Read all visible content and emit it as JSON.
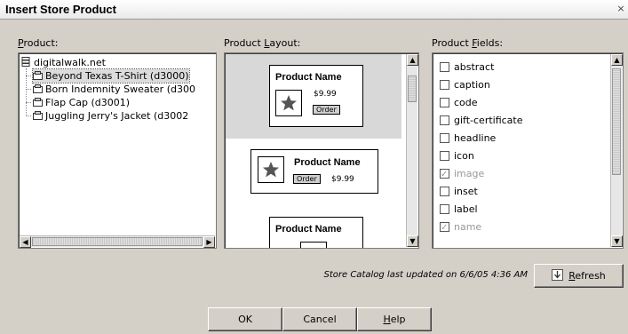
{
  "window": {
    "title": "Insert Store Product",
    "close_glyph": "×"
  },
  "product_panel": {
    "label_prefix": "",
    "label_underline": "P",
    "label_rest": "roduct:",
    "root": "digitalwalk.net",
    "items": [
      {
        "label": "Beyond Texas T-Shirt (d3000)",
        "selected": true
      },
      {
        "label": "Born Indemnity Sweater (d300",
        "selected": false
      },
      {
        "label": "Flap Cap (d3001)",
        "selected": false
      },
      {
        "label": "Juggling Jerry's Jacket (d3002",
        "selected": false
      }
    ]
  },
  "layout_panel": {
    "label_prefix": "Product ",
    "label_underline": "L",
    "label_rest": "ayout:",
    "layouts": [
      {
        "name": "Product Name",
        "price": "$9.99",
        "order": "Order",
        "selected": true
      },
      {
        "name": "Product Name",
        "price": "$9.99",
        "order": "Order",
        "selected": false
      },
      {
        "name": "Product Name",
        "selected": false
      }
    ]
  },
  "fields_panel": {
    "label_prefix": "Product ",
    "label_underline": "F",
    "label_rest": "ields:",
    "fields": [
      {
        "label": "abstract",
        "checked": false,
        "disabled": false
      },
      {
        "label": "caption",
        "checked": false,
        "disabled": false
      },
      {
        "label": "code",
        "checked": false,
        "disabled": false
      },
      {
        "label": "gift-certificate",
        "checked": false,
        "disabled": false
      },
      {
        "label": "headline",
        "checked": false,
        "disabled": false
      },
      {
        "label": "icon",
        "checked": false,
        "disabled": false
      },
      {
        "label": "image",
        "checked": true,
        "disabled": true
      },
      {
        "label": "inset",
        "checked": false,
        "disabled": false
      },
      {
        "label": "label",
        "checked": false,
        "disabled": false
      },
      {
        "label": "name",
        "checked": true,
        "disabled": true
      }
    ]
  },
  "status": {
    "text": "Store Catalog last updated on 6/6/05 4:36 AM"
  },
  "buttons": {
    "refresh_underline": "R",
    "refresh_rest": "efresh",
    "ok": "OK",
    "cancel": "Cancel",
    "help_underline": "H",
    "help_rest": "elp"
  }
}
